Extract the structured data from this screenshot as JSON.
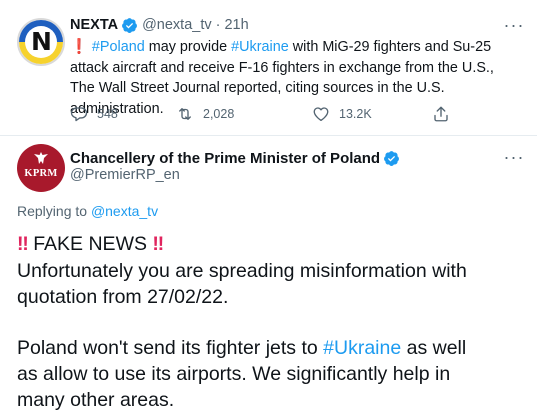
{
  "original_tweet": {
    "author_name": "NEXTA",
    "handle": "@nexta_tv",
    "separator": "·",
    "time": "21h",
    "text": {
      "alert_glyph": "❗",
      "hashtag_poland": "#Poland",
      "part1": " may provide ",
      "hashtag_ukraine": "#Ukraine",
      "part2": " with MiG-29 fighters and Su-25 attack aircraft and receive F-16 fighters in exchange from the U.S., The Wall Street Journal reported, citing sources in the U.S. administration."
    },
    "stats": {
      "replies": "548",
      "retweets": "2,028",
      "likes": "13.2K"
    },
    "icons": [
      "nexta-logo",
      "verified-badge",
      "more-icon",
      "reply-icon",
      "retweet-icon",
      "like-icon",
      "share-icon"
    ]
  },
  "reply_tweet": {
    "author_name": "Chancellery of the Prime Minister of Poland",
    "handle": "@PremierRP_en",
    "avatar_text": "KPRM",
    "replying_to_label": "Replying to",
    "replying_to_handle": "@nexta_tv",
    "body": {
      "alert_glyphs": "‼",
      "headline": "FAKE NEWS",
      "line2": "Unfortunately you are spreading misinformation with",
      "line3": "quotation from 27/02/22.",
      "line4_part1": "Poland won't send its fighter jets to ",
      "hashtag_ukraine": "#Ukraine",
      "line4_part2": " as well",
      "line5": "as allow to use its airports. We significantly help in",
      "line6": "many other areas."
    }
  },
  "colors": {
    "link_blue": "#1d9bf0",
    "secondary_text": "#536471",
    "alert_red": "#e0245e",
    "kprm_red": "#a8192c",
    "verified_blue": "#1d9bf0"
  }
}
